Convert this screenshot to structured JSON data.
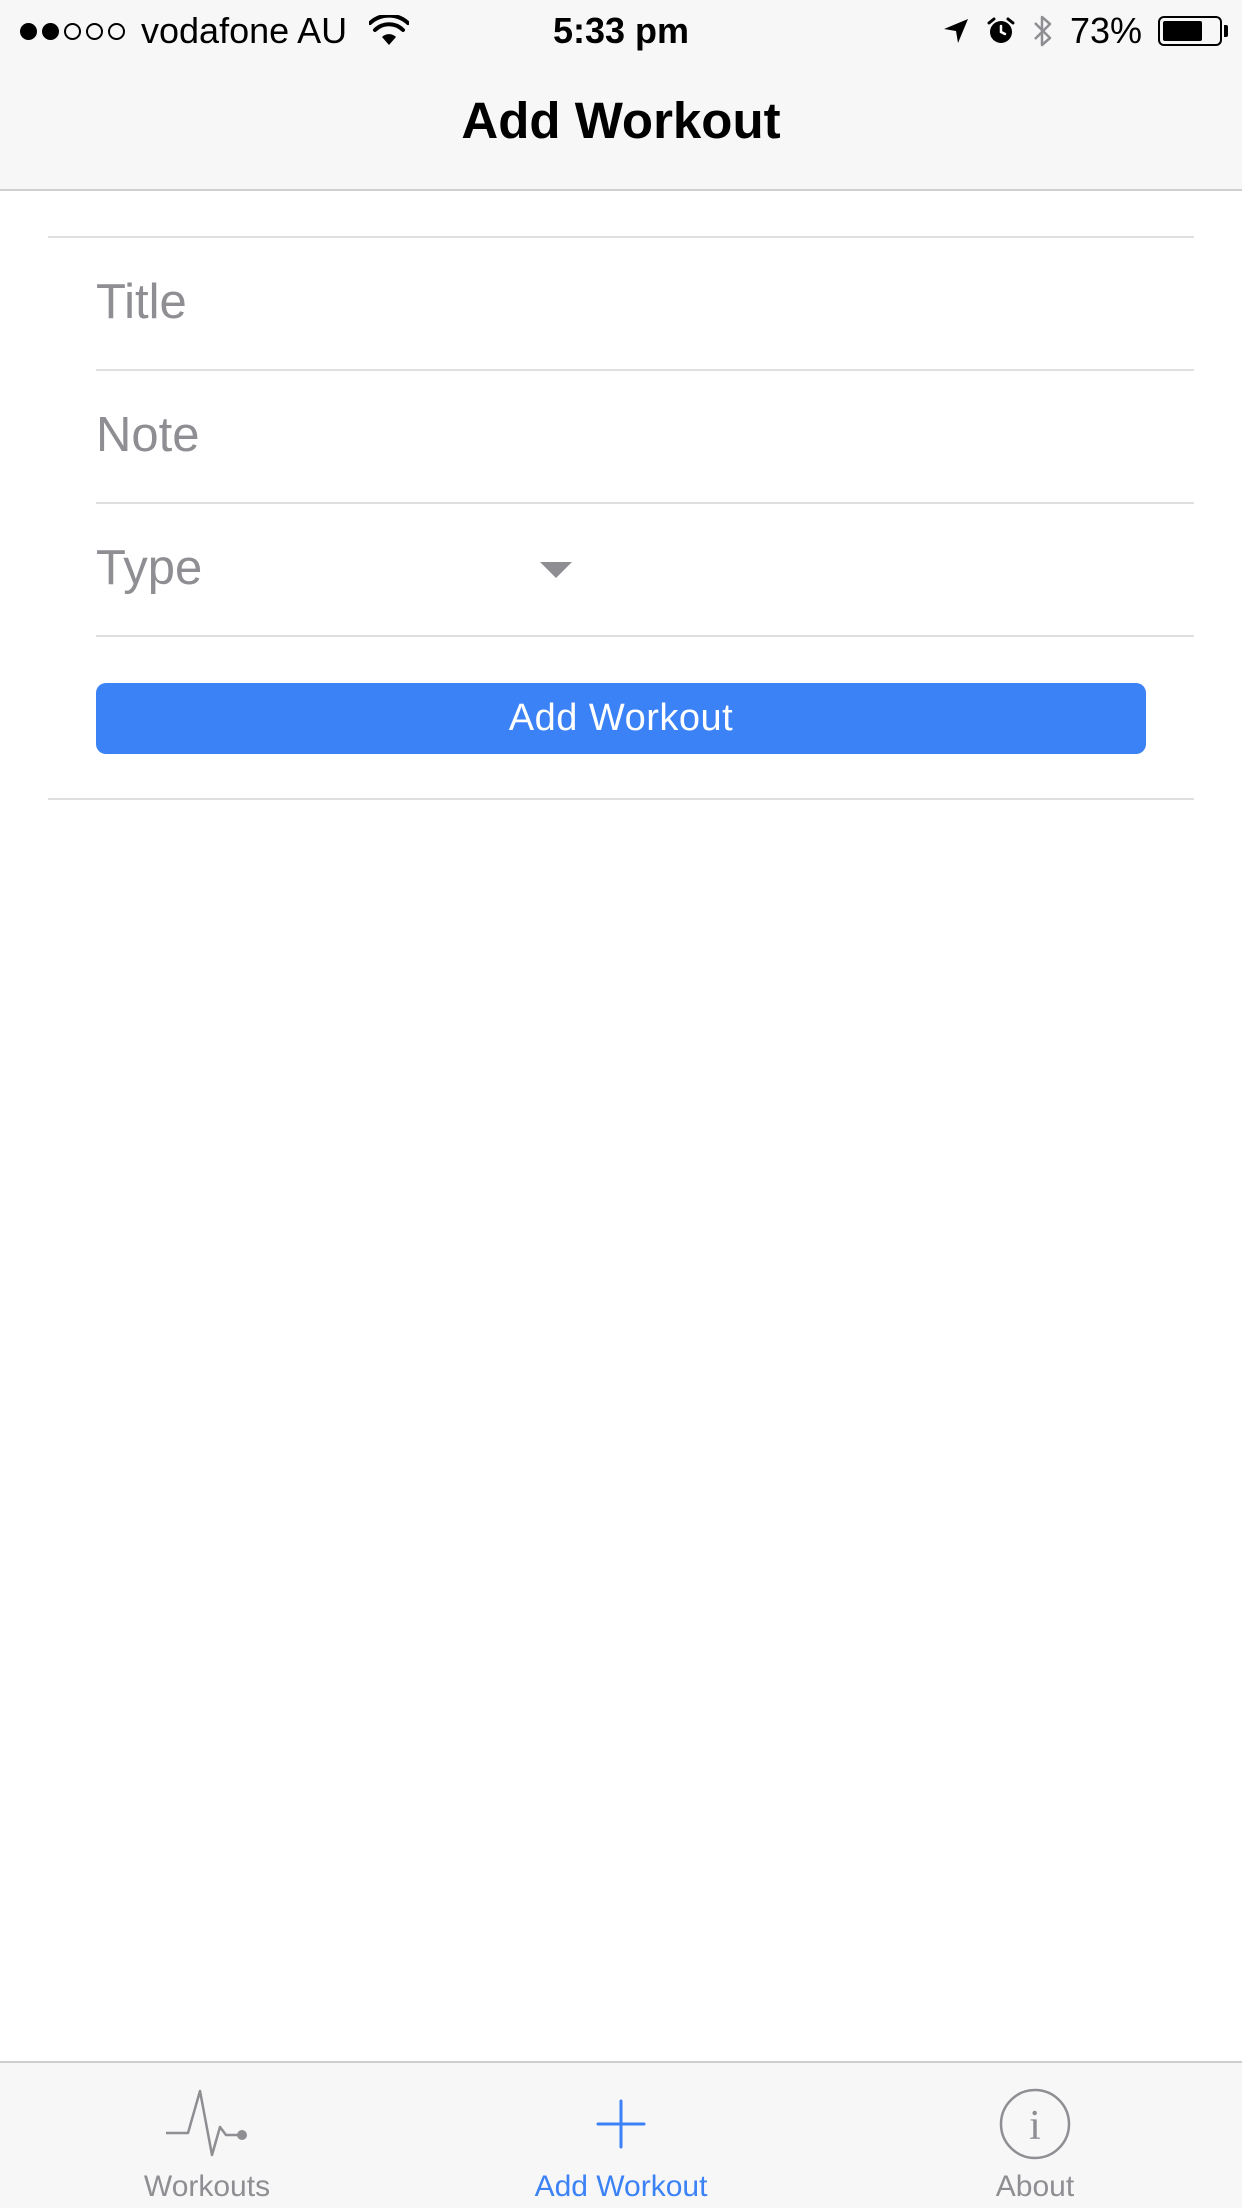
{
  "status_bar": {
    "carrier": "vodafone AU",
    "time": "5:33 pm",
    "battery_percent": "73%",
    "battery_level": 0.73,
    "signal_strength": 2,
    "signal_total": 5,
    "icons": [
      "wifi-icon",
      "location-arrow-icon",
      "alarm-icon",
      "bluetooth-icon",
      "battery-icon"
    ]
  },
  "nav": {
    "title": "Add Workout"
  },
  "form": {
    "title_placeholder": "Title",
    "title_value": "",
    "note_placeholder": "Note",
    "note_value": "",
    "type_label": "Type",
    "submit_label": "Add Workout"
  },
  "tab_bar": {
    "tabs": [
      {
        "label": "Workouts",
        "icon": "heartbeat-icon",
        "active": false
      },
      {
        "label": "Add Workout",
        "icon": "plus-icon",
        "active": true
      },
      {
        "label": "About",
        "icon": "info-icon",
        "active": false
      }
    ]
  },
  "colors": {
    "accent": "#3b82f6",
    "bar_background": "#f7f7f7",
    "placeholder": "#8e8e93",
    "separator": "#e0e0e0"
  }
}
